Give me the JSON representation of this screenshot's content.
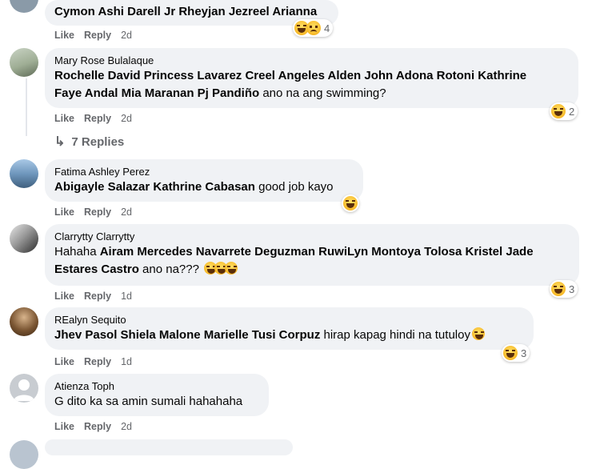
{
  "comments": [
    {
      "author": "",
      "tags": "Cymon Ashi Darell Jr Rheyjan Jezreel Arianna",
      "text": "",
      "actions": {
        "like": "Like",
        "reply": "Reply",
        "time": "2d"
      },
      "reactions": {
        "icons": [
          "haha-icon",
          "sad-icon"
        ],
        "count": "4"
      }
    },
    {
      "author": "Mary Rose Bulalaque",
      "tags_line1": "Rochelle David Princess Lavarez Creel Angeles Alden John Adona Rotoni Kathrine",
      "tags_line2": "Faye Andal Mia Maranan Pj Pandiño",
      "text": " ano na ang swimming?",
      "actions": {
        "like": "Like",
        "reply": "Reply",
        "time": "2d"
      },
      "reactions": {
        "icons": [
          "haha-icon"
        ],
        "count": "2"
      },
      "replies_label": "7 Replies"
    },
    {
      "author": "Fatima Ashley Perez",
      "tags": "Abigayle Salazar Kathrine Cabasan",
      "text": " good job kayo",
      "actions": {
        "like": "Like",
        "reply": "Reply",
        "time": "2d"
      },
      "reactions": {
        "icons": [
          "haha-icon"
        ],
        "count": ""
      }
    },
    {
      "author": "Clarrytty Clarrytty",
      "text_prefix": "Hahaha ",
      "tags_line1": "Airam Mercedes Navarrete Deguzman RuwiLyn Montoya Tolosa Kristel Jade",
      "tags_line2": "Estares Castro",
      "text": " ano na???",
      "actions": {
        "like": "Like",
        "reply": "Reply",
        "time": "1d"
      },
      "reactions": {
        "icons": [
          "haha-icon"
        ],
        "count": "3"
      }
    },
    {
      "author": "REalyn Sequito",
      "tags": "Jhev Pasol Shiela Malone Marielle Tusi Corpuz",
      "text": " hirap kapag hindi na tutuloy",
      "actions": {
        "like": "Like",
        "reply": "Reply",
        "time": "1d"
      },
      "reactions": {
        "icons": [
          "haha-icon"
        ],
        "count": "3"
      }
    },
    {
      "author": "Atienza Toph",
      "text": "G dito ka sa amin sumali hahahaha",
      "actions": {
        "like": "Like",
        "reply": "Reply",
        "time": "2d"
      }
    }
  ]
}
